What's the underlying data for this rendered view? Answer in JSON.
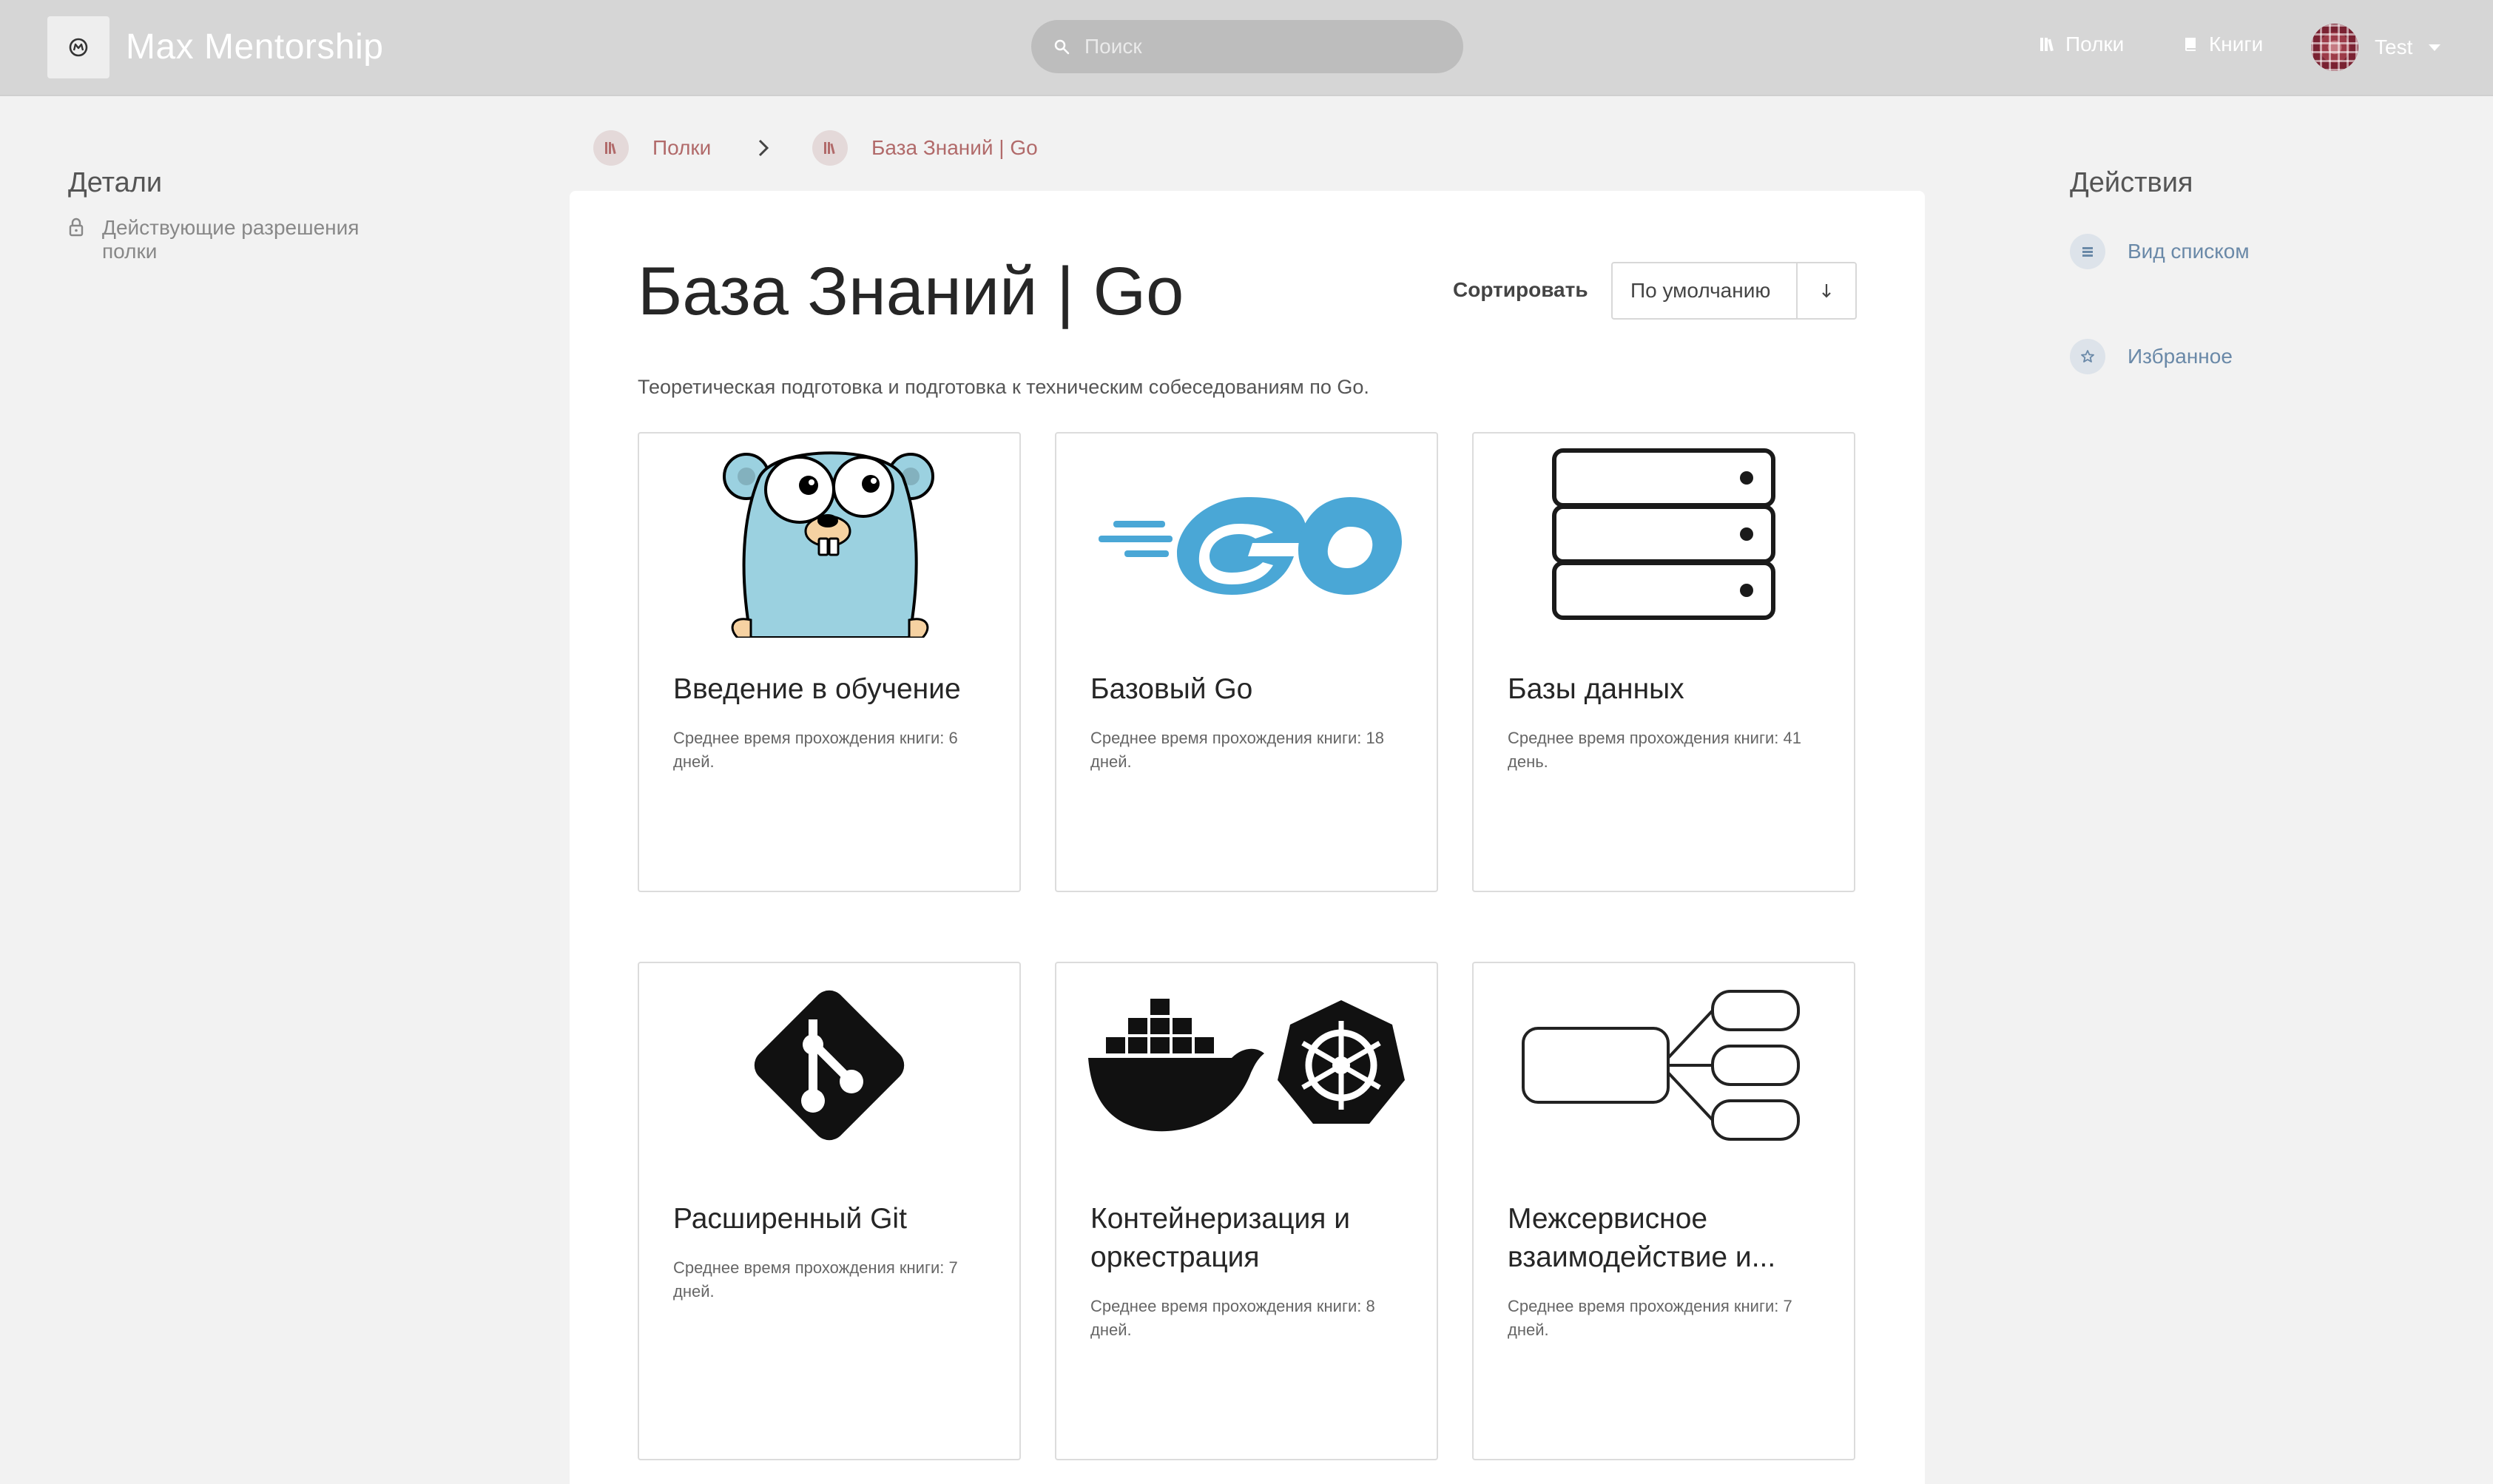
{
  "header": {
    "app_title": "Max Mentorship",
    "search_placeholder": "Поиск",
    "nav": {
      "shelves": "Полки",
      "books": "Книги"
    },
    "user_name": "Test"
  },
  "left": {
    "title": "Детали",
    "permissions": "Действующие разрешения полки"
  },
  "breadcrumb": {
    "root": "Полки",
    "current": "База Знаний | Go"
  },
  "main": {
    "title": "База Знаний | Go",
    "sort_label": "Сортировать",
    "sort_value": "По умолчанию",
    "description": "Теоретическая подготовка и подготовка к техническим собеседованиям по Go.",
    "books": [
      {
        "name": "Введение в обучение",
        "meta": "Среднее время прохождения книги: 6 дней.",
        "cover_icon": "gopher-mascot-icon"
      },
      {
        "name": "Базовый Go",
        "meta": "Среднее время прохождения книги: 18 дней.",
        "cover_icon": "go-logo-icon"
      },
      {
        "name": "Базы данных",
        "meta": "Среднее время прохождения книги: 41 день.",
        "cover_icon": "database-server-icon"
      },
      {
        "name": "Расширенный Git",
        "meta": "Среднее время прохождения книги: 7 дней.",
        "cover_icon": "git-logo-icon"
      },
      {
        "name": "Контейнеризация и оркестрация",
        "meta": "Среднее время прохождения книги: 8 дней.",
        "cover_icon": "docker-kubernetes-icon"
      },
      {
        "name": "Межсервисное взаимодействие и...",
        "meta": "Среднее время прохождения книги: 7 дней.",
        "cover_icon": "service-diagram-icon"
      }
    ]
  },
  "right": {
    "title": "Действия",
    "actions": {
      "list_view": "Вид списком",
      "favorites": "Избранное"
    }
  },
  "colors": {
    "header_bg": "#d6d6d6",
    "page_bg": "#f2f2f2",
    "breadcrumb_accent": "#b16a6a",
    "action_accent": "#6a89a8",
    "go_blue": "#4aa7d6",
    "gopher_blue": "#9bd1e0"
  }
}
